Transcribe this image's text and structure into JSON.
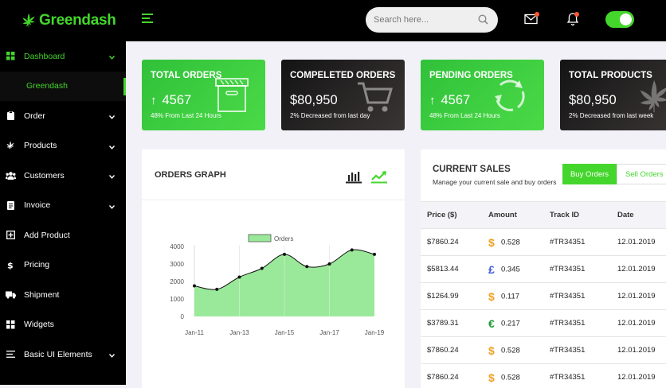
{
  "app": {
    "brand": "Greendash"
  },
  "colors": {
    "accent": "#44d62c",
    "dark": "#000000",
    "euro": "#1f9a3a",
    "pound": "#3b5bdb",
    "dollar": "#f0a020"
  },
  "sidebar": {
    "items": [
      {
        "label": "Dashboard",
        "icon": "grid-icon",
        "chevron": true,
        "active": true
      },
      {
        "label": "Order",
        "icon": "clipboard-icon",
        "chevron": true
      },
      {
        "label": "Products",
        "icon": "cannabis-leaf-icon",
        "chevron": true
      },
      {
        "label": "Customers",
        "icon": "users-icon",
        "chevron": true
      },
      {
        "label": "Invoice",
        "icon": "document-icon",
        "chevron": true
      },
      {
        "label": "Add Product",
        "icon": "plus-square-icon",
        "chevron": false
      },
      {
        "label": "Pricing",
        "icon": "dollar-icon",
        "chevron": false
      },
      {
        "label": "Shipment",
        "icon": "truck-icon",
        "chevron": false
      },
      {
        "label": "Widgets",
        "icon": "widgets-icon",
        "chevron": false
      },
      {
        "label": "Basic UI Elements",
        "icon": "list-icon",
        "chevron": true
      }
    ],
    "sub_item": "Greendash"
  },
  "topbar": {
    "search_placeholder": "Search here..."
  },
  "cards": [
    {
      "title": "TOTAL ORDERS",
      "value": "4567",
      "arrow": "↑",
      "sub": "48% From Last 24 Hours",
      "icon": "archive-box-icon",
      "style": "green"
    },
    {
      "title": "COMPELETED ORDERS",
      "value": "$80,950",
      "arrow": "",
      "sub": "2% Decreased from last day",
      "icon": "shopping-cart-icon",
      "style": "dark"
    },
    {
      "title": "PENDING ORDERS",
      "value": "4567",
      "arrow": "↑",
      "sub": "48% From Last 24 Hours",
      "icon": "refresh-icon",
      "style": "green"
    },
    {
      "title": "TOTAL PRODUCTS",
      "value": "$80,950",
      "arrow": "",
      "sub": "2% Decreased from last week",
      "icon": "cannabis-leaf-icon",
      "style": "dark"
    }
  ],
  "graph": {
    "title": "ORDERS GRAPH",
    "chart_data": {
      "type": "area",
      "legend": [
        "Orders"
      ],
      "x_ticks": [
        "Jan-11",
        "Jan-13",
        "Jan-15",
        "Jan-17",
        "Jan-19"
      ],
      "y_ticks": [
        "4000",
        "3000",
        "2000",
        "1000",
        "0"
      ],
      "ylim": [
        0,
        4000
      ],
      "series": [
        {
          "name": "Orders",
          "points": [
            [
              "Jan-11",
              1750
            ],
            [
              "Jan-12",
              1550
            ],
            [
              "Jan-13",
              2250
            ],
            [
              "Jan-14",
              2750
            ],
            [
              "Jan-15",
              3550
            ],
            [
              "Jan-16",
              2850
            ],
            [
              "Jan-17",
              3000
            ],
            [
              "Jan-18",
              3800
            ],
            [
              "Jan-19",
              3550
            ]
          ]
        }
      ]
    }
  },
  "sales": {
    "title": "CURRENT SALES",
    "subtitle": "Manage your current sale and buy orders",
    "buy_label": "Buy Orders",
    "sell_label": "Sell Orders",
    "columns": [
      "Price ($)",
      "Amount",
      "Track ID",
      "Date"
    ],
    "rows": [
      {
        "price": "$7860.24",
        "currency": "$",
        "cur_color": "#f0a020",
        "amount": "0.528",
        "track": "#TR34351",
        "date": "12.01.2019"
      },
      {
        "price": "$5813.44",
        "currency": "£",
        "cur_color": "#3b5bdb",
        "amount": "0.345",
        "track": "#TR34351",
        "date": "12.01.2019"
      },
      {
        "price": "$1264.99",
        "currency": "$",
        "cur_color": "#f0a020",
        "amount": "0.117",
        "track": "#TR34351",
        "date": "12.01.2019"
      },
      {
        "price": "$3789.31",
        "currency": "€",
        "cur_color": "#1f9a3a",
        "amount": "0.217",
        "track": "#TR34351",
        "date": "12.01.2019"
      },
      {
        "price": "$7860.24",
        "currency": "$",
        "cur_color": "#f0a020",
        "amount": "0.528",
        "track": "#TR34351",
        "date": "12.01.2019"
      },
      {
        "price": "$7860.24",
        "currency": "$",
        "cur_color": "#f0a020",
        "amount": "0.528",
        "track": "#TR34351",
        "date": "12.01.2019"
      }
    ]
  }
}
